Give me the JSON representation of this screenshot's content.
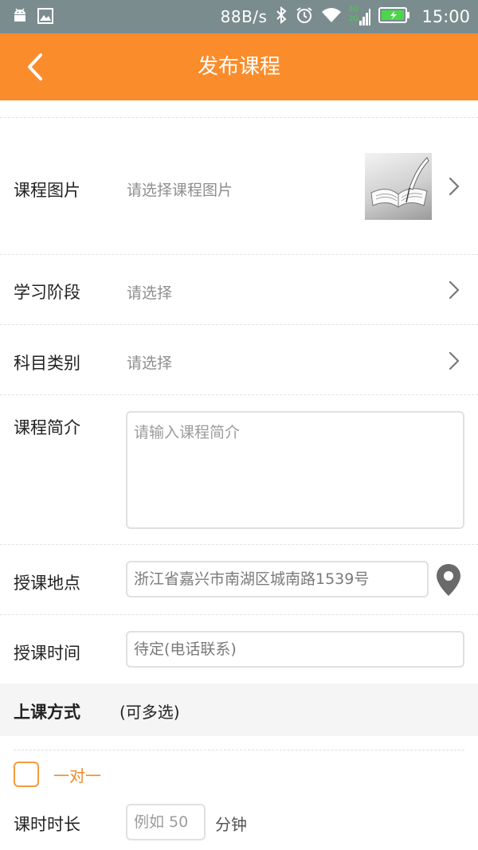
{
  "status_bar": {
    "left_icons": [
      "android-icon",
      "image-icon"
    ],
    "speed": "88B/s",
    "network_badge_top": "4G",
    "network_badge_bottom": "2G",
    "time": "15:00"
  },
  "header": {
    "title": "发布课程"
  },
  "form": {
    "image": {
      "label": "课程图片",
      "hint": "请选择课程图片"
    },
    "stage": {
      "label": "学习阶段",
      "hint": "请选择"
    },
    "subject": {
      "label": "科目类别",
      "hint": "请选择"
    },
    "intro": {
      "label": "课程简介",
      "placeholder": "请输入课程简介"
    },
    "location": {
      "label": "授课地点",
      "value": "浙江省嘉兴市南湖区城南路1539号"
    },
    "time": {
      "label": "授课时间",
      "value": "待定(电话联系)"
    }
  },
  "method_section": {
    "label": "上课方式",
    "note": "(可多选)",
    "options": [
      {
        "label": "一对一",
        "checked": false
      }
    ]
  },
  "duration": {
    "label": "课时时长",
    "placeholder": "例如 50",
    "unit": "分钟"
  },
  "colors": {
    "header": "#fb8c2b",
    "accent": "#f08a2a",
    "status_bar": "#7b8c8f"
  }
}
